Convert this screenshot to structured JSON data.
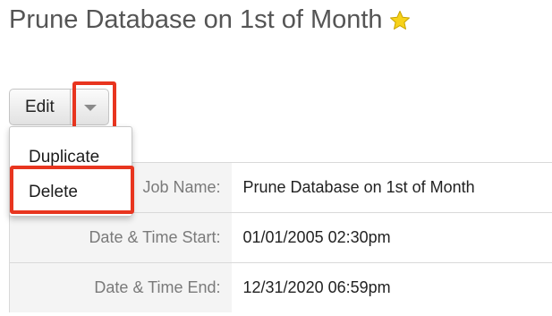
{
  "header": {
    "title": "Prune Database on 1st of Month",
    "favorite_icon": "star-icon",
    "favorite_color": "#f7d21a"
  },
  "actions": {
    "edit_label": "Edit",
    "dropdown_icon": "caret-down-icon",
    "menu": {
      "items": [
        {
          "label": "Duplicate"
        },
        {
          "label": "Delete"
        }
      ]
    }
  },
  "details": {
    "rows": [
      {
        "label": "Job Name:",
        "value": "Prune Database on 1st of Month"
      },
      {
        "label": "Date & Time Start:",
        "value": "01/01/2005 02:30pm"
      },
      {
        "label": "Date & Time End:",
        "value": "12/31/2020 06:59pm"
      }
    ]
  },
  "highlight_color": "#e8351f"
}
